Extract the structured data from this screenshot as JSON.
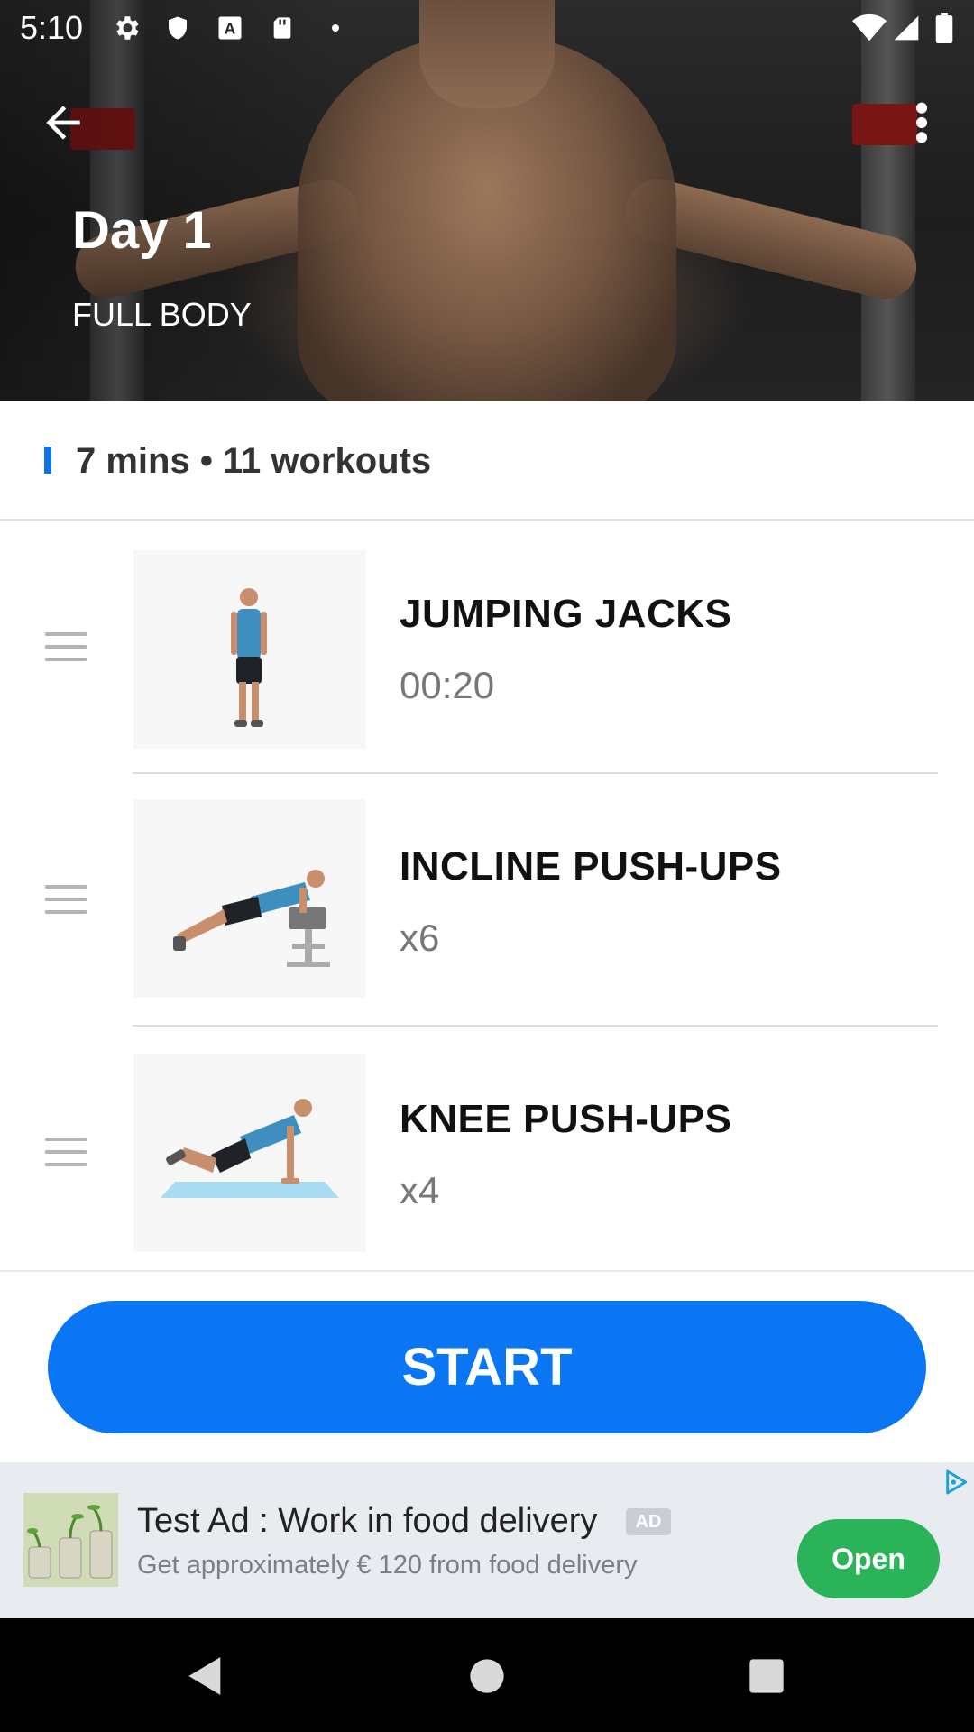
{
  "status_bar": {
    "time": "5:10",
    "left_icons": [
      "gear-icon",
      "shield-icon",
      "text-a-icon",
      "sd-card-icon",
      "dot-icon"
    ],
    "right_icons": [
      "wifi-icon",
      "signal-icon",
      "battery-icon"
    ]
  },
  "header": {
    "title": "Day 1",
    "subtitle": "FULL BODY",
    "back_icon": "arrow-back-icon",
    "menu_icon": "more-vertical-icon"
  },
  "summary": {
    "text": "7 mins • 11 workouts",
    "accent_color": "#1173e8"
  },
  "exercises": [
    {
      "name": "JUMPING JACKS",
      "meta": "00:20",
      "illustration": "standing-man-illustration"
    },
    {
      "name": "INCLINE PUSH-UPS",
      "meta": "x6",
      "illustration": "incline-pushup-illustration"
    },
    {
      "name": "KNEE PUSH-UPS",
      "meta": "x4",
      "illustration": "knee-pushup-illustration"
    }
  ],
  "start_button": {
    "label": "START",
    "color": "#0a76f4"
  },
  "ad": {
    "title": "Test Ad : Work in food delivery",
    "badge": "AD",
    "description": "Get approximately € 120 from food delivery",
    "cta": "Open",
    "cta_color": "#2ab359"
  },
  "nav_bar": {
    "buttons": [
      "back-triangle-icon",
      "home-circle-icon",
      "recents-square-icon"
    ]
  }
}
